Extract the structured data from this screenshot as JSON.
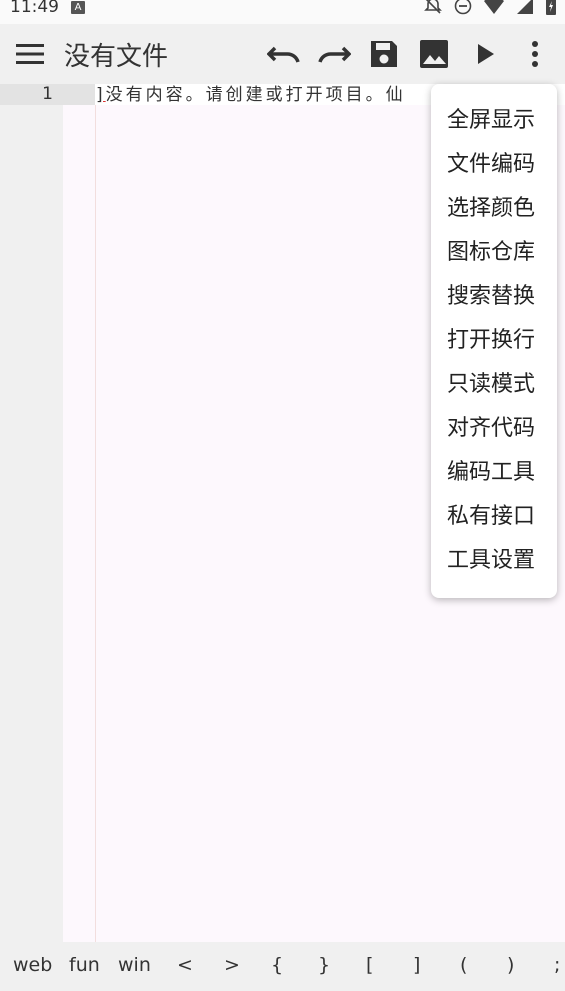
{
  "status_bar": {
    "time": "11:49",
    "badge": "A",
    "icons": [
      "notifications-off-icon",
      "do-not-disturb-icon",
      "wifi-icon",
      "cell-signal-icon",
      "battery-icon"
    ]
  },
  "app_bar": {
    "title": "没有文件",
    "icons": [
      "menu-icon",
      "undo-icon",
      "redo-icon",
      "save-icon",
      "image-icon",
      "run-icon",
      "more-vert-icon"
    ]
  },
  "editor": {
    "line_number": "1",
    "cursor_char": "]",
    "line_text": "没有内容。请创建或打开项目。仙"
  },
  "menu": {
    "items": [
      "全屏显示",
      "文件编码",
      "选择颜色",
      "图标仓库",
      "搜索替换",
      "打开换行",
      "只读模式",
      "对齐代码",
      "编码工具",
      "私有接口",
      "工具设置"
    ]
  },
  "symbols": [
    "web",
    "fun",
    "win",
    "<",
    ">",
    "{",
    "}",
    "[",
    "]",
    "(",
    ")",
    ";"
  ],
  "colors": {
    "background": "#f0f0f0",
    "editor_bg": "#fdf8fd",
    "current_line": "#ffffff",
    "gutter_line": "#e3e3e3",
    "icon": "#333333"
  }
}
